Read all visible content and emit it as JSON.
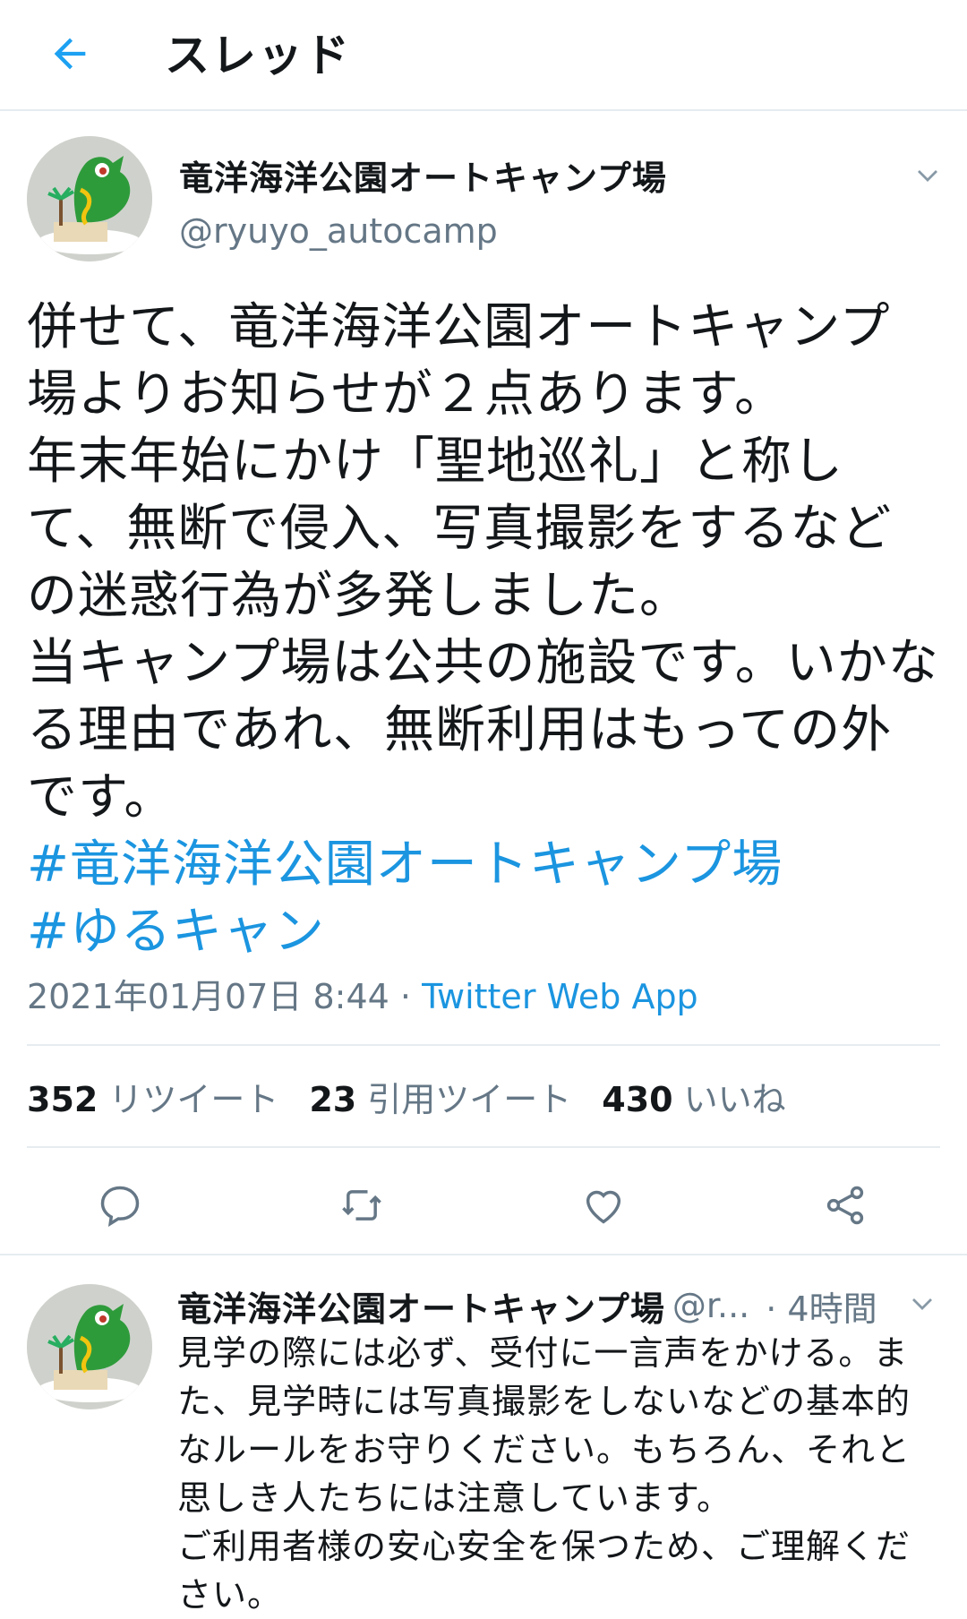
{
  "header": {
    "title": "スレッド",
    "back_icon": "arrow-left-icon",
    "accent": "#1da1f2"
  },
  "tweet": {
    "author_name": "竜洋海洋公園オートキャンプ場",
    "handle": "@ryuyo_autocamp",
    "body_lines": [
      "併せて、竜洋海洋公園オートキャンプ場よりお知らせが２点あります。",
      "年末年始にかけ「聖地巡礼」と称して、無断で侵入、写真撮影をするなどの迷惑行為が多発しました。",
      "当キャンプ場は公共の施設です。いかなる理由であれ、無断利用はもっての外です。"
    ],
    "hashtags": [
      "#竜洋海洋公園オートキャンプ場",
      "#ゆるキャン"
    ],
    "timestamp": "2021年01月07日 8:44",
    "separator": " · ",
    "source": "Twitter Web App",
    "stats": [
      {
        "count": "352",
        "label": "リツイート"
      },
      {
        "count": "23",
        "label": "引用ツイート"
      },
      {
        "count": "430",
        "label": "いいね"
      }
    ],
    "actions": [
      "reply-icon",
      "retweet-icon",
      "like-icon",
      "share-icon"
    ]
  },
  "reply": {
    "author_name": "竜洋海洋公園オートキャンプ場",
    "handle": "@r...",
    "time": "· 4時間",
    "body_lines": [
      "見学の際には必ず、受付に一言声をかける。また、見学時には写真撮影をしないなどの基本的なルールをお守りください。もちろん、それと思しき人たちには注意しています。",
      "ご利用者様の安心安全を保つため、ご理解ください。"
    ]
  },
  "colors": {
    "text": "#14171a",
    "secondary": "#657786",
    "link": "#1b95e0",
    "divider": "#e6ecf0"
  }
}
